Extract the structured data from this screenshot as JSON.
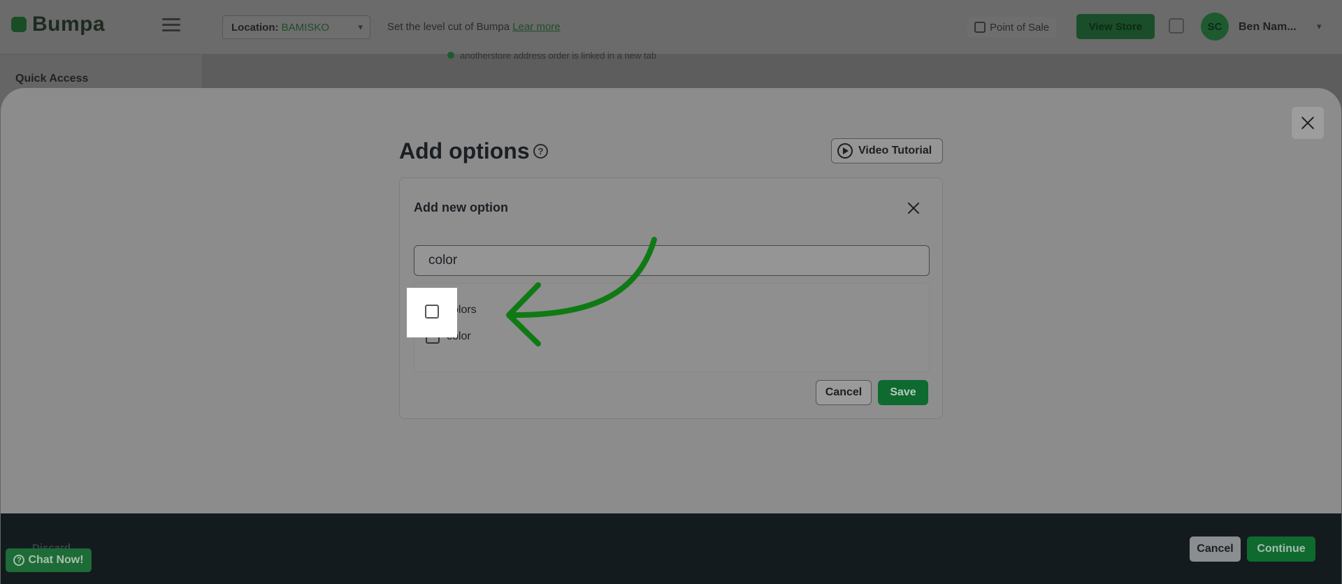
{
  "app": {
    "logo_text": "Bumpa",
    "location_label": "Location:",
    "location_value": "BAMISKO",
    "location_hint": "Set the level cut of Bumpa",
    "location_hint_link": "Lear more",
    "point_of_sale": "Point of Sale",
    "view_store": "View Store",
    "avatar_initials": "SC",
    "user_name": "Ben Nam...",
    "sidebar_section": "Quick Access",
    "background_note": "anotherstore address order is linked in a new tab"
  },
  "modal": {
    "title": "Add options",
    "video_tutorial_label": "Video Tutorial",
    "card": {
      "title": "Add new option",
      "search_value": "color",
      "suggestions": [
        {
          "label": "colors",
          "checked": false
        },
        {
          "label": "color",
          "checked": false
        }
      ],
      "cancel_label": "Cancel",
      "save_label": "Save"
    }
  },
  "footer": {
    "left_text": "Discard",
    "cancel_label": "Cancel",
    "continue_label": "Continue"
  },
  "chat": {
    "label": "Chat Now!"
  },
  "colors": {
    "brand_green": "#0e6a2f",
    "annotation_arrow": "#0f7a14",
    "footer_dark": "#131b1f"
  }
}
